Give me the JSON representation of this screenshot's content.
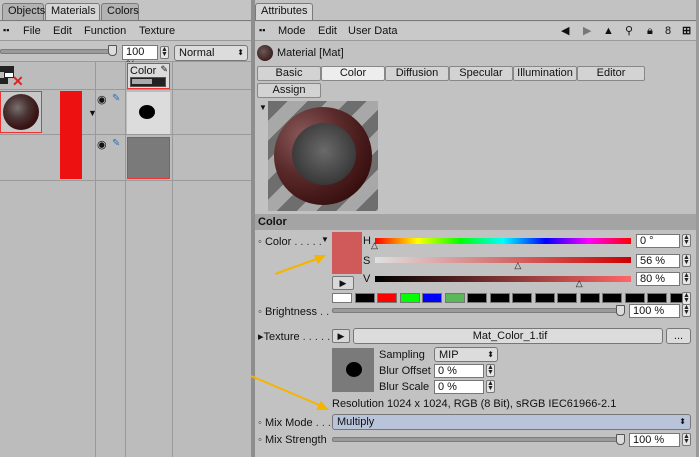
{
  "left_panel": {
    "tabs": [
      "Objects",
      "Materials",
      "Colors"
    ],
    "active_tab": "Materials",
    "menu": [
      "File",
      "Edit",
      "Function",
      "Texture"
    ],
    "zoom_value": "100 %",
    "blend_mode": "Normal",
    "layer_label": "Color"
  },
  "right_panel": {
    "tab": "Attributes",
    "menu": [
      "Mode",
      "Edit",
      "User Data"
    ],
    "material_title": "Material [Mat]",
    "subtabs_row1": [
      "Basic",
      "Color",
      "Diffusion",
      "Specular",
      "Illumination",
      "Editor"
    ],
    "subtabs_row2": [
      "Assign"
    ],
    "active_subtab": "Color",
    "section_title": "Color",
    "color": {
      "label": "Color",
      "swatch_color": "#d05a5a",
      "h_label": "H",
      "s_label": "S",
      "v_label": "V",
      "h_value": "0 °",
      "s_value": "56 %",
      "v_value": "80 %",
      "s_fraction": 0.56,
      "v_fraction": 0.8,
      "preset_swatches": [
        "#ffffff",
        "#000000",
        "#ff0000",
        "#00ff00",
        "#0000ff",
        "#5ab85a",
        "#000000",
        "#000000",
        "#000000",
        "#000000",
        "#000000",
        "#000000",
        "#000000",
        "#000000",
        "#000000",
        "#000000"
      ]
    },
    "brightness": {
      "label": "Brightness",
      "value": "100 %",
      "fraction": 1.0
    },
    "texture": {
      "label": "Texture",
      "file": "Mat_Color_1.tif",
      "more_button": "...",
      "sampling_label": "Sampling",
      "sampling_value": "MIP",
      "blur_offset_label": "Blur Offset",
      "blur_offset_value": "0 %",
      "blur_scale_label": "Blur Scale",
      "blur_scale_value": "0 %",
      "resolution": "Resolution 1024 x 1024, RGB (8 Bit), sRGB IEC61966-2.1"
    },
    "mix_mode": {
      "label": "Mix Mode",
      "value": "Multiply"
    },
    "mix_strength": {
      "label": "Mix Strength",
      "value": "100 %",
      "fraction": 1.0
    }
  },
  "colors": {
    "accent_red": "#ee1111",
    "annotation_arrow": "#f4b400"
  }
}
